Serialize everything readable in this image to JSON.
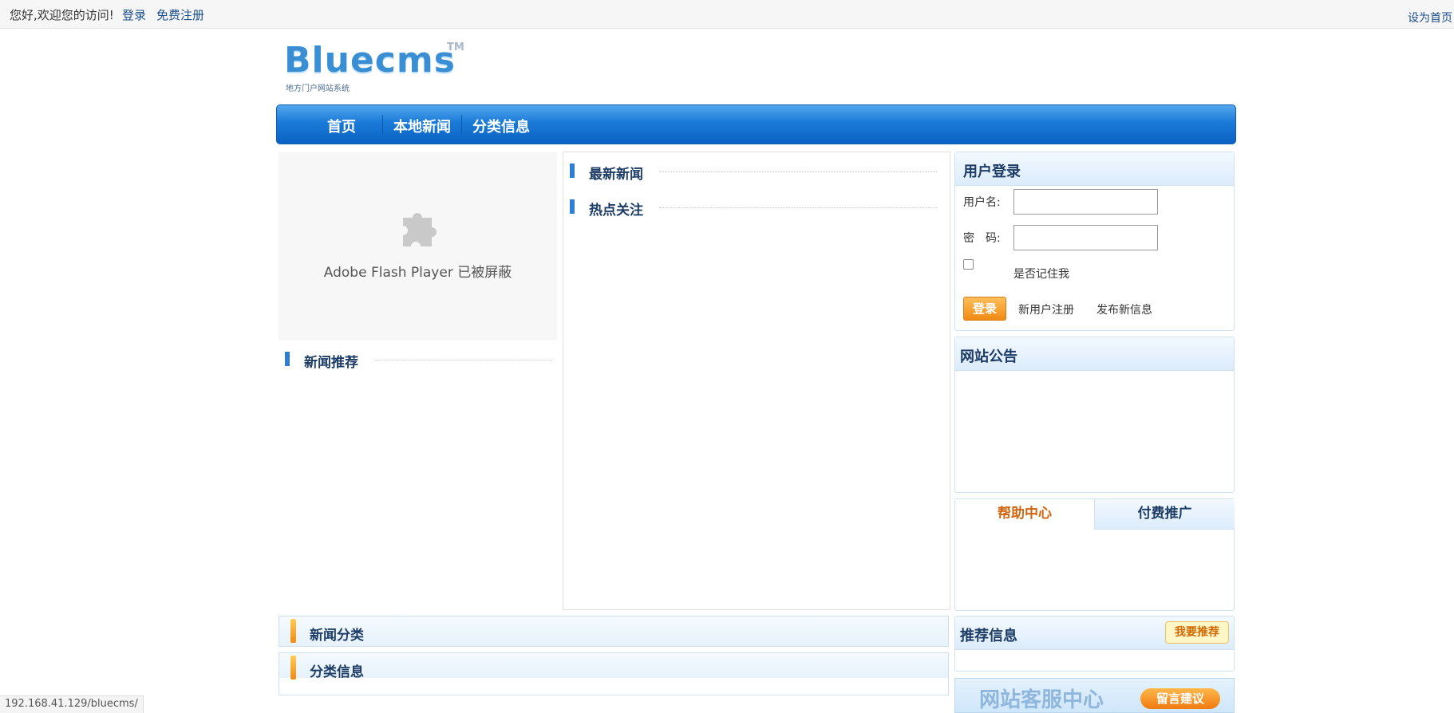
{
  "topbar": {
    "greeting": "您好,欢迎您的访问!",
    "login_link": "登录",
    "register_link": "免费注册",
    "set_homepage": "设为首页"
  },
  "logo": {
    "brand": "Bluecms",
    "tm": "TM",
    "subtitle": "地方门户网站系统"
  },
  "nav": {
    "items": [
      "首页",
      "本地新闻",
      "分类信息"
    ]
  },
  "flash": {
    "icon": "puzzle-plugin-icon",
    "message": "Adobe Flash Player 已被屏蔽"
  },
  "left": {
    "news_recommend": "新闻推荐"
  },
  "middle": {
    "latest_news": "最新新闻",
    "hot_topics": "热点关注"
  },
  "login_box": {
    "title": "用户登录",
    "username_label": "用户名:",
    "password_label": "密　码:",
    "username_value": "",
    "password_value": "",
    "remember_label": "是否记住我",
    "login_button": "登录",
    "register_link": "新用户注册",
    "post_link": "发布新信息"
  },
  "notice_box": {
    "title": "网站公告"
  },
  "tabs_box": {
    "tabs": [
      "帮助中心",
      "付费推广"
    ],
    "active_color": "#d2640e"
  },
  "bottom": {
    "news_category": "新闻分类",
    "classified_info": "分类信息"
  },
  "recommend_box": {
    "title": "推荐信息",
    "button": "我要推荐"
  },
  "service_banner": {
    "title": "网站客服中心",
    "button": "留言建议"
  },
  "status_bar": {
    "url": "192.168.41.129/bluecms/"
  },
  "colors": {
    "nav_blue": "#1a7ad8",
    "title_navy": "#1e3d66",
    "accent_orange": "#f08a12"
  }
}
